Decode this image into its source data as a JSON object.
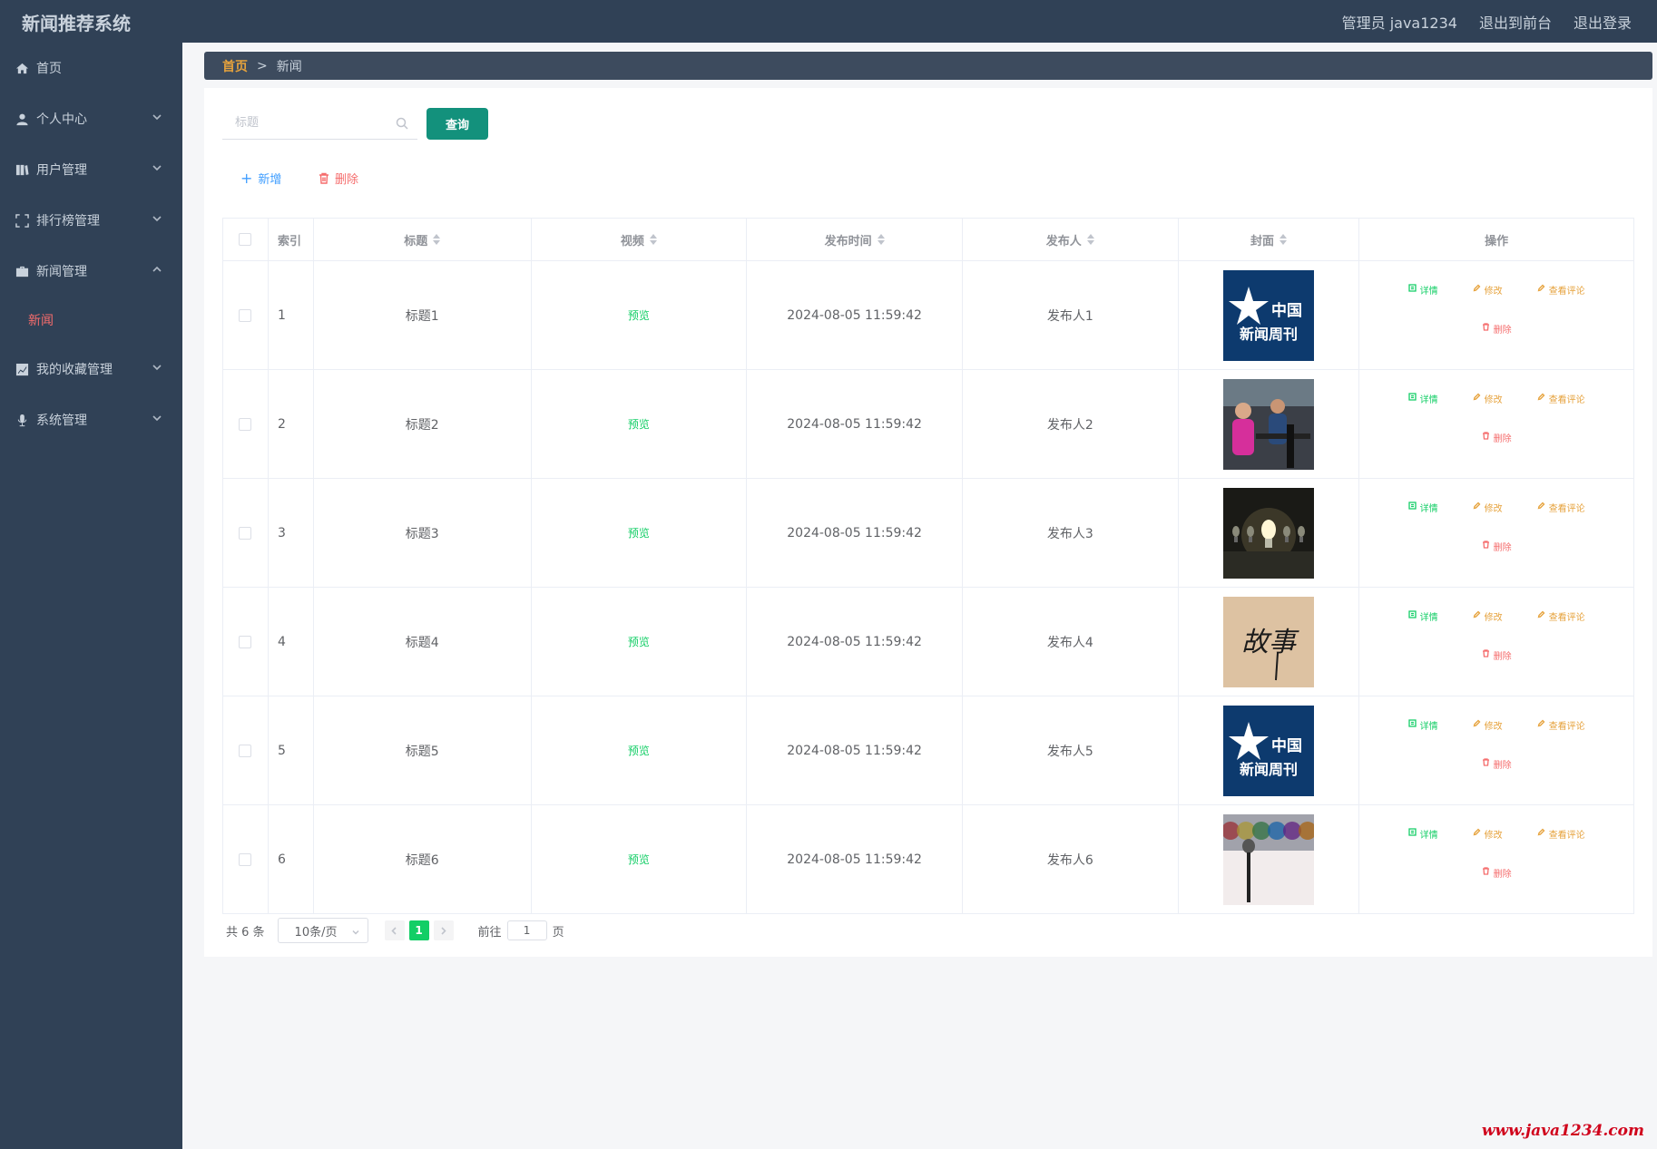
{
  "header": {
    "app_title": "新闻推荐系统",
    "admin_label": "管理员 java1234",
    "to_front": "退出到前台",
    "logout": "退出登录"
  },
  "sidebar": {
    "items": [
      {
        "label": "首页",
        "icon": "home-icon",
        "expandable": false
      },
      {
        "label": "个人中心",
        "icon": "user-icon",
        "expandable": true
      },
      {
        "label": "用户管理",
        "icon": "book-icon",
        "expandable": true
      },
      {
        "label": "排行榜管理",
        "icon": "fullscreen-icon",
        "expandable": true
      },
      {
        "label": "新闻管理",
        "icon": "briefcase-icon",
        "expandable": true,
        "expanded": true
      },
      {
        "label": "我的收藏管理",
        "icon": "chart-icon",
        "expandable": true
      },
      {
        "label": "系统管理",
        "icon": "mic-icon",
        "expandable": true
      }
    ],
    "active_sub": "新闻"
  },
  "breadcrumb": {
    "home": "首页",
    "sep": ">",
    "current": "新闻"
  },
  "search": {
    "placeholder": "标题",
    "value": "",
    "query_label": "查询"
  },
  "toolbar": {
    "add_label": "新增",
    "delete_label": "删除"
  },
  "table": {
    "headers": {
      "index": "索引",
      "title": "标题",
      "video": "视频",
      "time": "发布时间",
      "publisher": "发布人",
      "cover": "封面",
      "ops": "操作"
    },
    "rows": [
      {
        "index": "1",
        "title": "标题1",
        "video": "预览",
        "time": "2024-08-05 11:59:42",
        "publisher": "发布人1",
        "cover": "weekly-logo",
        "cover_text": "中国 新闻周刊"
      },
      {
        "index": "2",
        "title": "标题2",
        "video": "预览",
        "time": "2024-08-05 11:59:42",
        "publisher": "发布人2",
        "cover": "gym-photo"
      },
      {
        "index": "3",
        "title": "标题3",
        "video": "预览",
        "time": "2024-08-05 11:59:42",
        "publisher": "发布人3",
        "cover": "bulb-photo"
      },
      {
        "index": "4",
        "title": "标题4",
        "video": "预览",
        "time": "2024-08-05 11:59:42",
        "publisher": "发布人4",
        "cover": "calligraphy-photo",
        "cover_text": "故事"
      },
      {
        "index": "5",
        "title": "标题5",
        "video": "预览",
        "time": "2024-08-05 11:59:42",
        "publisher": "发布人5",
        "cover": "weekly-logo",
        "cover_text": "中国 新闻周刊"
      },
      {
        "index": "6",
        "title": "标题6",
        "video": "预览",
        "time": "2024-08-05 11:59:42",
        "publisher": "发布人6",
        "cover": "mic-photo"
      }
    ],
    "ops": {
      "detail": "详情",
      "edit": "修改",
      "comment": "查看评论",
      "remove": "删除"
    }
  },
  "pagination": {
    "total": "共 6 条",
    "page_size": "10条/页",
    "current_page": "1",
    "goto_label": "前往",
    "goto_value": "1",
    "page_suffix": "页"
  },
  "watermark": "www.java1234.com",
  "colors": {
    "sidebar_bg": "#304156",
    "primary_teal": "#13917c",
    "success": "#13ce66",
    "warning": "#e6a23c",
    "danger": "#f56c6c"
  }
}
